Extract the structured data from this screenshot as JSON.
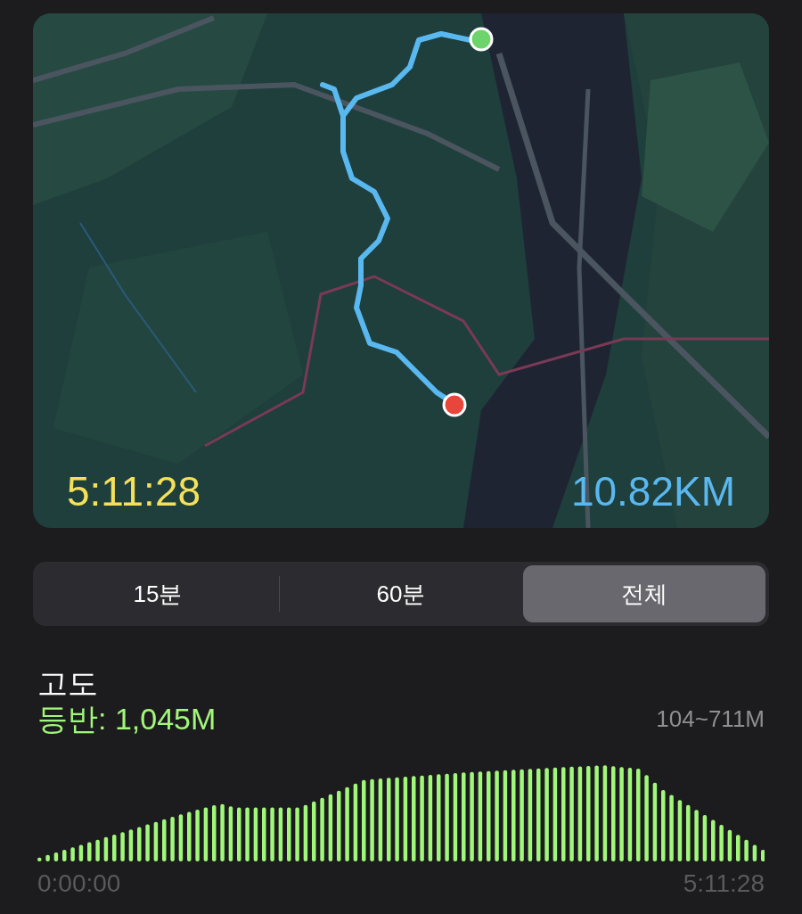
{
  "map": {
    "kind": "picture",
    "duration": "5:11:28",
    "distance": "10.82KM"
  },
  "segments": [
    {
      "label": "15분",
      "selected": false
    },
    {
      "label": "60분",
      "selected": false
    },
    {
      "label": "전체",
      "selected": true
    }
  ],
  "elevation": {
    "title": "고도",
    "climb": "등반: 1,045M",
    "range": "104~711M",
    "start_time": "0:00:00",
    "end_time": "5:11:28"
  }
}
